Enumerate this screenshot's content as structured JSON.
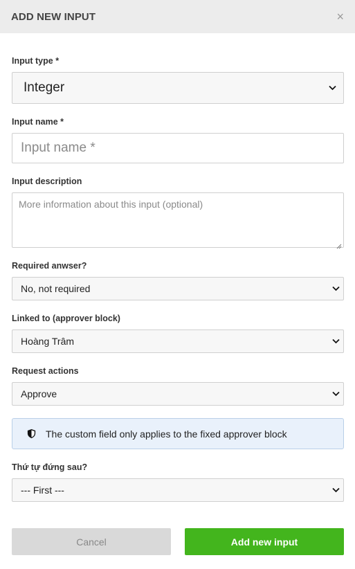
{
  "header": {
    "title": "ADD NEW INPUT",
    "close_label": "×"
  },
  "form": {
    "input_type": {
      "label": "Input type *",
      "value": "Integer"
    },
    "input_name": {
      "label": "Input name *",
      "placeholder": "Input name *",
      "value": ""
    },
    "input_description": {
      "label": "Input description",
      "placeholder": "More information about this input (optional)",
      "value": ""
    },
    "required": {
      "label": "Required anwser?",
      "value": "No, not required"
    },
    "linked_to": {
      "label": "Linked to (approver block)",
      "value": "Hoàng Trâm"
    },
    "request_actions": {
      "label": "Request actions",
      "value": "Approve"
    },
    "notice": {
      "icon": "shield-icon",
      "text": "The custom field only applies to the fixed approver block"
    },
    "order_after": {
      "label": "Thứ tự đứng sau?",
      "value": "--- First ---"
    }
  },
  "actions": {
    "cancel_label": "Cancel",
    "add_label": "Add new input"
  },
  "colors": {
    "primary_button": "#43b51d",
    "notice_background": "#e9f1fb",
    "header_background": "#ececec"
  }
}
